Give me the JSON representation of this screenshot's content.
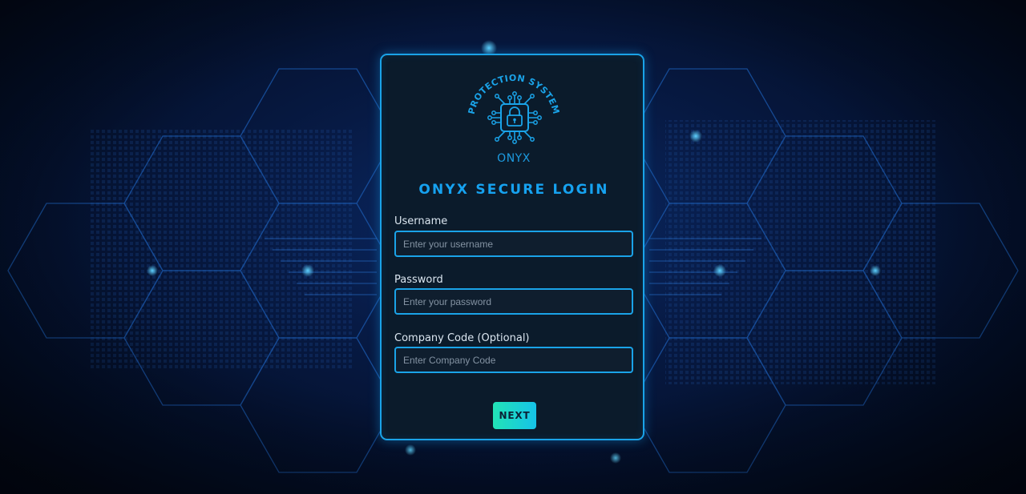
{
  "brand": {
    "logo_arc_text": "PROTECTION SYSTEM",
    "logo_name": "ONYX"
  },
  "login": {
    "title": "ONYX SECURE LOGIN",
    "username": {
      "label": "Username",
      "placeholder": "Enter your username",
      "value": ""
    },
    "password": {
      "label": "Password",
      "placeholder": "Enter your password",
      "value": ""
    },
    "company_code": {
      "label": "Company Code (Optional)",
      "placeholder": "Enter Company Code",
      "value": ""
    },
    "next_label": "NEXT"
  },
  "icons": [
    "padlock-chip-icon",
    "circuit-trace-icon"
  ],
  "colors": {
    "accent": "#1aa3e8",
    "card_bg": "#0b1b2b",
    "page_bg": "#04112e",
    "button_gradient_start": "#22e4b6",
    "button_gradient_end": "#16c3e8",
    "label_text": "#dbe6f0"
  }
}
